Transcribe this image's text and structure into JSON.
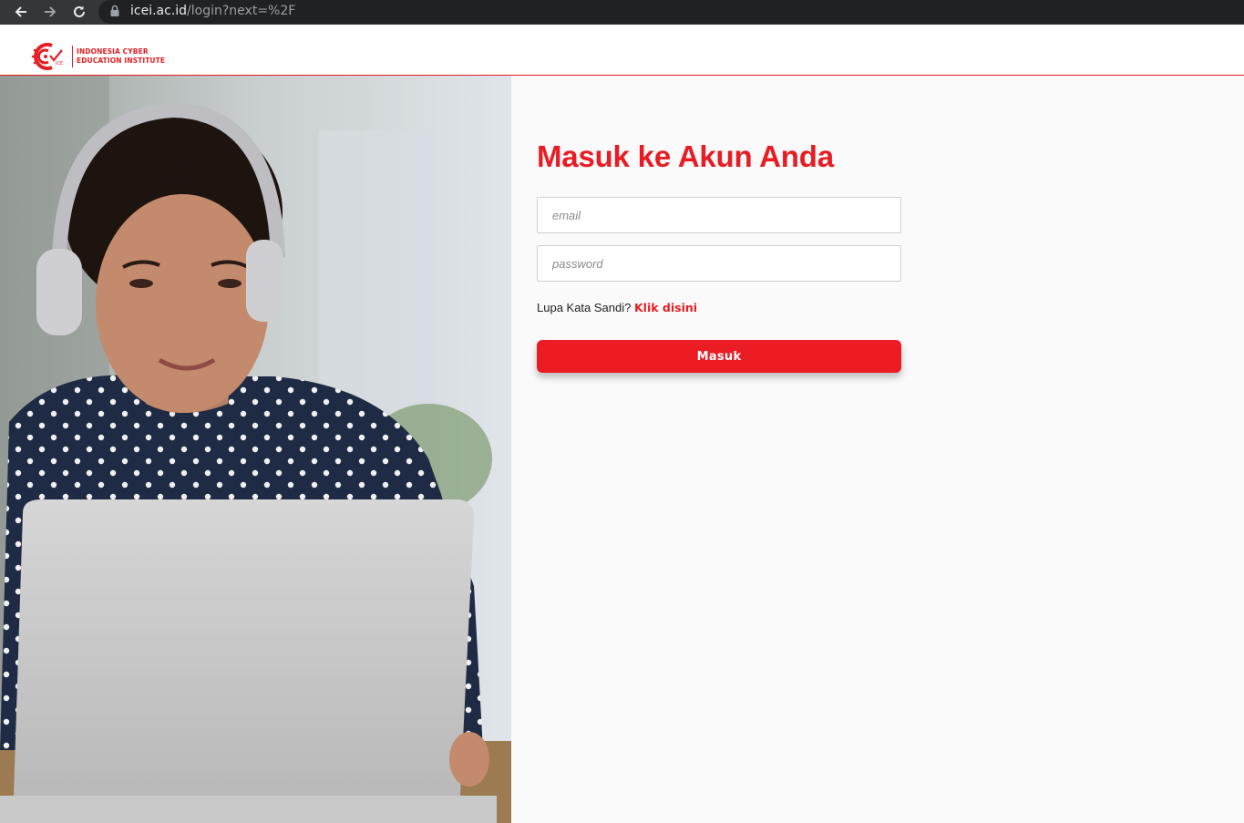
{
  "browser": {
    "url_host": "icei.ac.id",
    "url_path": "/login?next=%2F",
    "icons": [
      "back-arrow-icon",
      "forward-arrow-icon",
      "reload-icon",
      "lock-icon"
    ]
  },
  "header": {
    "logo_line1": "INDONESIA CYBER",
    "logo_line2": "EDUCATION INSTITUTE",
    "logo_mark_text": "ICE"
  },
  "login": {
    "title": "Masuk ke Akun Anda",
    "email_placeholder": "email",
    "password_placeholder": "password",
    "forgot_prefix": "Lupa Kata Sandi?",
    "forgot_link": "Klik disini",
    "submit_label": "Masuk"
  },
  "colors": {
    "brand_red": "#e81c24",
    "browser_bar": "#35363a",
    "panel_bg": "#fafafa"
  }
}
